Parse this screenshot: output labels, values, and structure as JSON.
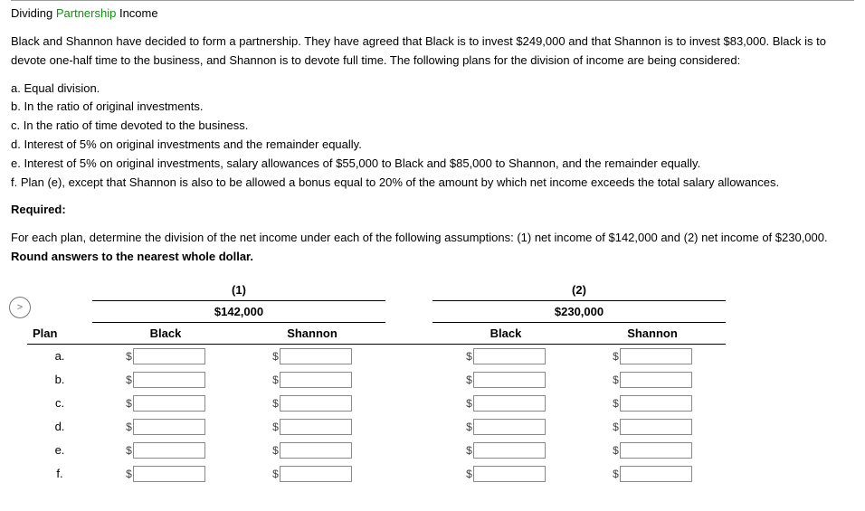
{
  "title": {
    "pre": "Dividing ",
    "green": "Partnership",
    "post": " Income"
  },
  "intro": "Black and Shannon have decided to form a partnership. They have agreed that Black is to invest $249,000 and that Shannon is to invest $83,000. Black is to devote one-half time to the business, and Shannon is to devote full time. The following plans for the division of income are being considered:",
  "items": {
    "a": "a. Equal division.",
    "b": "b. In the ratio of original investments.",
    "c": "c. In the ratio of time devoted to the business.",
    "d": "d. Interest of 5% on original investments and the remainder equally.",
    "e": "e. Interest of 5% on original investments, salary allowances of $55,000 to Black and $85,000 to Shannon, and the remainder equally.",
    "f": "f. Plan (e), except that Shannon is also to be allowed a bonus equal to 20% of the amount by which net income exceeds the total salary allowances."
  },
  "required": "Required:",
  "instr": {
    "part1": "For each plan, determine the division of the net income under each of the following assumptions: (1) net income of $142,000 and (2) net income of $230,000. ",
    "bold": "Round answers to the nearest whole dollar."
  },
  "circle": ">",
  "table": {
    "col1": "(1)",
    "col2": "(2)",
    "amt1": "$142,000",
    "amt2": "$230,000",
    "plan": "Plan",
    "black": "Black",
    "shannon": "Shannon",
    "rows": [
      "a.",
      "b.",
      "c.",
      "d.",
      "e.",
      "f."
    ],
    "sym": "$"
  }
}
